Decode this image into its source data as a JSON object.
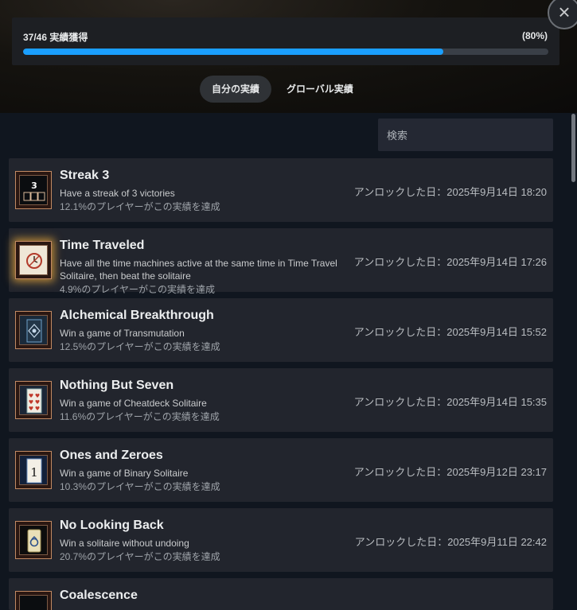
{
  "progress": {
    "count_label": "37/46 実績獲得",
    "percent_label": "(80%)",
    "fraction": 0.8,
    "accent_color": "#1a9fff"
  },
  "close": {
    "icon": "×"
  },
  "tabs": [
    {
      "label": "自分の実績",
      "active": true
    },
    {
      "label": "グローバル実績",
      "active": false
    }
  ],
  "search": {
    "placeholder": "検索"
  },
  "achievements": [
    {
      "title": "Streak 3",
      "description": "Have a streak of 3 victories",
      "percent": "12.1%のプレイヤーがこの実績を達成",
      "unlocked": "アンロックした日：2025年9月14日 18:20",
      "icon": "streak-icon"
    },
    {
      "title": "Time Traveled",
      "description": "Have all the time machines active at the same time in Time Travel Solitaire, then beat the solitaire",
      "percent": "4.9%のプレイヤーがこの実績を達成",
      "unlocked": "アンロックした日：2025年9月14日 17:26",
      "icon": "clock-card-icon"
    },
    {
      "title": "Alchemical Breakthrough",
      "description": "Win a game of Transmutation",
      "percent": "12.5%のプレイヤーがこの実績を達成",
      "unlocked": "アンロックした日：2025年9月14日 15:52",
      "icon": "alchemy-card-icon"
    },
    {
      "title": "Nothing But Seven",
      "description": "Win a game of Cheatdeck Solitaire",
      "percent": "11.6%のプレイヤーがこの実績を達成",
      "unlocked": "アンロックした日：2025年9月14日 15:35",
      "icon": "hearts-card-icon"
    },
    {
      "title": "Ones and Zeroes",
      "description": "Win a game of Binary Solitaire",
      "percent": "10.3%のプレイヤーがこの実績を達成",
      "unlocked": "アンロックした日：2025年9月12日 23:17",
      "icon": "binary-card-icon"
    },
    {
      "title": "No Looking Back",
      "description": "Win a solitaire without undoing",
      "percent": "20.7%のプレイヤーがこの実績を達成",
      "unlocked": "アンロックした日：2025年9月11日 22:42",
      "icon": "undo-card-icon"
    },
    {
      "title": "Coalescence",
      "description": "",
      "percent": "",
      "unlocked": "",
      "icon": "card-icon"
    }
  ]
}
